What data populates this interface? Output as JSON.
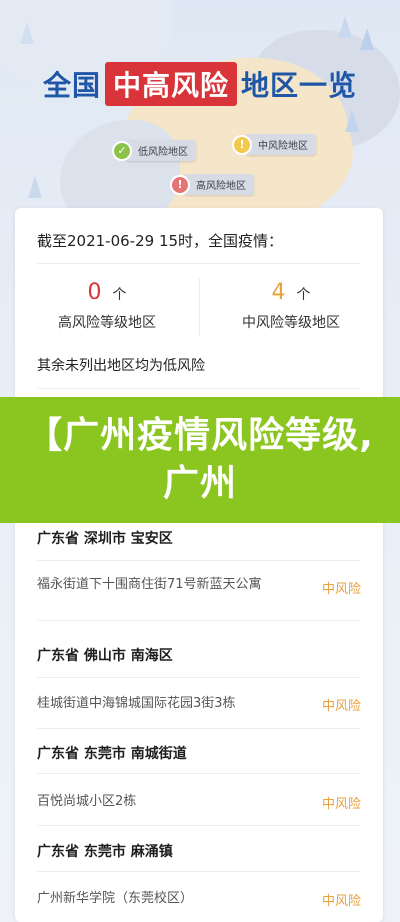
{
  "header": {
    "title_prefix": "全国",
    "title_highlight": "中高风险",
    "title_suffix": "地区一览"
  },
  "map_pins": {
    "low_label": "低风险地区",
    "mid_label": "中风险地区",
    "high_label": "高风险地区",
    "low_color": "#8bc34a",
    "mid_color": "#f2c94c",
    "high_color": "#e57373"
  },
  "summary": {
    "as_of": "截至2021-06-29 15时，全国疫情：",
    "high": {
      "count": "0",
      "unit": "个",
      "label": "高风险等级地区",
      "color": "#d8343a"
    },
    "mid": {
      "count": "4",
      "unit": "个",
      "label": "中风险等级地区",
      "color": "#e9a23b"
    },
    "note": "其余未列出地区均为低风险"
  },
  "banner": {
    "text": "【广州疫情风险等级,广州"
  },
  "areas": [
    {
      "region": "广东省 深圳市 宝安区",
      "location": "福永街道下十围商住街71号新蓝天公寓",
      "risk": "中风险"
    },
    {
      "region": "广东省 佛山市 南海区",
      "location": "桂城街道中海锦城国际花园3街3栋",
      "risk": "中风险"
    },
    {
      "region": "广东省 东莞市 南城街道",
      "location": "百悦尚城小区2栋",
      "risk": "中风险"
    },
    {
      "region": "广东省 东莞市 麻涌镇",
      "location": "广州新华学院（东莞校区）",
      "risk": "中风险"
    }
  ]
}
